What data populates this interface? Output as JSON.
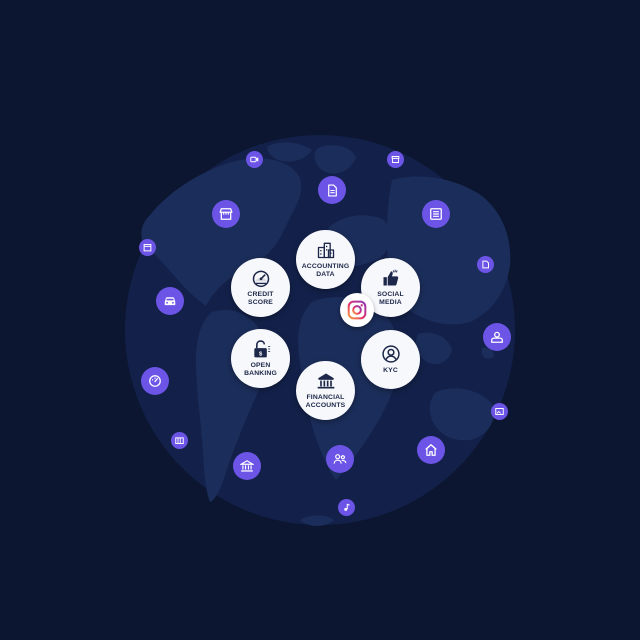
{
  "colors": {
    "background": "#0c1630",
    "globe": "#14224a",
    "land": "#1a2b57",
    "accent": "#6c55e6",
    "node": "#f7f8fb",
    "text": "#1c2749"
  },
  "nodes": {
    "accounting": {
      "label": "ACCOUNTING\nDATA",
      "icon": "buildings-chart-icon"
    },
    "credit": {
      "label": "CREDIT\nSCORE",
      "icon": "gauge-icon"
    },
    "social": {
      "label": "SOCIAL\nMEDIA",
      "icon": "thumbs-up-icon"
    },
    "open_banking": {
      "label": "OPEN\nBANKING",
      "icon": "unlocked-lock-icon"
    },
    "kyc": {
      "label": "KYC",
      "icon": "user-circle-icon"
    },
    "financial": {
      "label": "FINANCIAL\nACCOUNTS",
      "icon": "bank-icon"
    }
  },
  "center_icon": "instagram-icon",
  "orbit_icons": [
    "video-icon",
    "storefront-icon",
    "document-icon",
    "receipt-icon",
    "newspaper-icon",
    "calendar-icon",
    "car-icon",
    "file-icon",
    "user-icon",
    "speedometer-icon",
    "image-icon",
    "wallet-icon",
    "bank-icon",
    "people-icon",
    "home-icon",
    "music-icon"
  ]
}
